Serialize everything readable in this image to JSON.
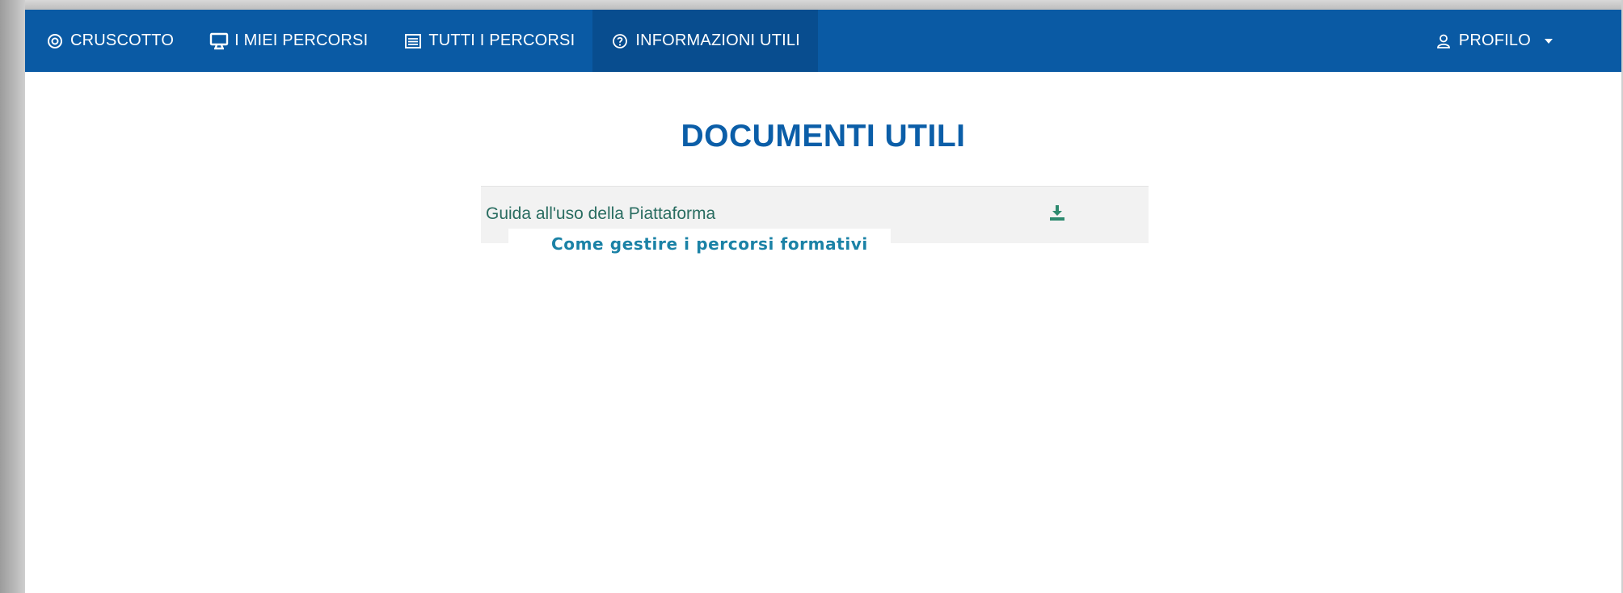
{
  "navbar": {
    "items": [
      {
        "label": "CRUSCOTTO",
        "icon": "dashboard-icon",
        "active": false
      },
      {
        "label": "I MIEI PERCORSI",
        "icon": "monitor-icon",
        "active": false
      },
      {
        "label": "TUTTI I PERCORSI",
        "icon": "list-icon",
        "active": false
      },
      {
        "label": "INFORMAZIONI UTILI",
        "icon": "help-circle-icon",
        "active": true
      }
    ],
    "profile": {
      "label": "PROFILO",
      "icon": "user-icon"
    }
  },
  "main": {
    "title": "DOCUMENTI UTILI",
    "documents": [
      {
        "name": "Guida all'uso della Piattaforma",
        "action_icon": "download-icon"
      }
    ]
  },
  "callout": {
    "text": "Come gestire i percorsi formativi"
  },
  "colors": {
    "navbar": "#0a5aa4",
    "navbar_active": "#084d8f",
    "title": "#0b5ea8",
    "document_link": "#2a6d61",
    "callout_text": "#1b82a6"
  }
}
